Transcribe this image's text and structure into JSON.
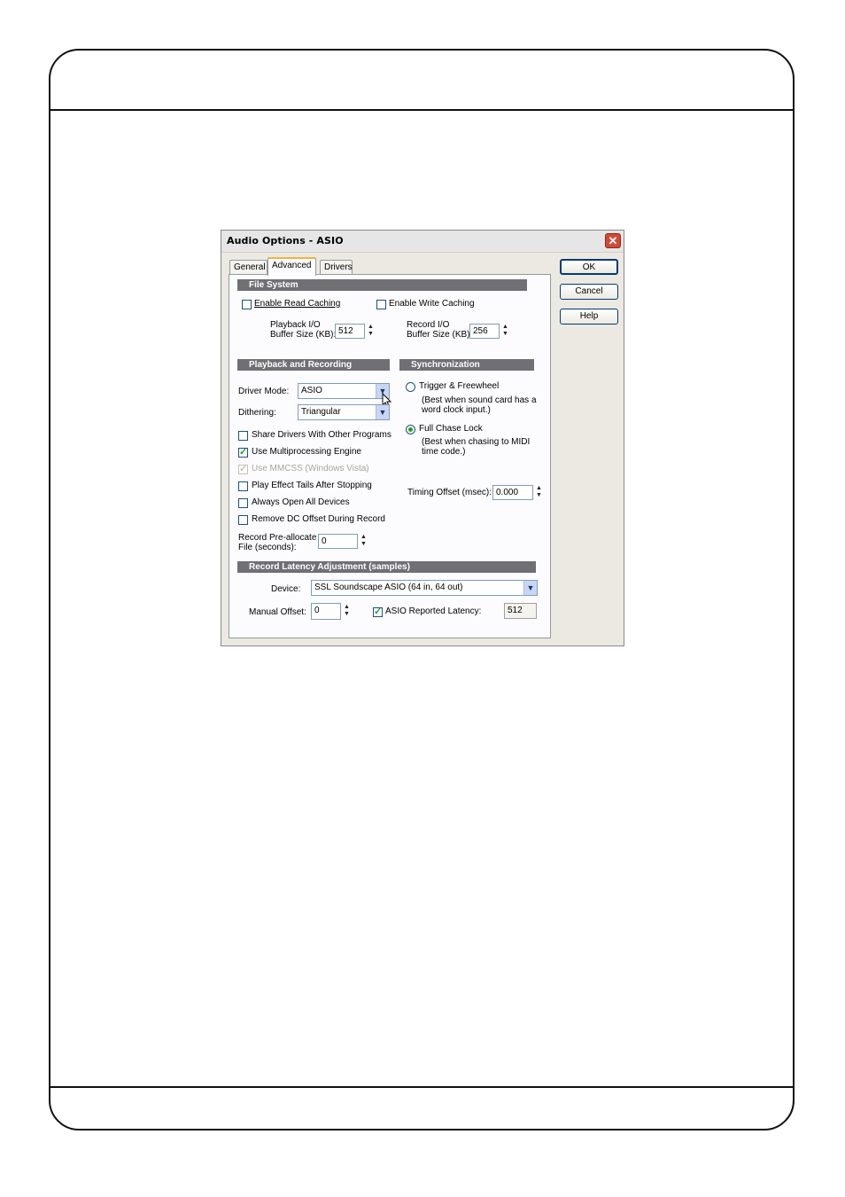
{
  "dialog": {
    "title": "Audio Options - ASIO",
    "close_glyph": "✕"
  },
  "tabs": [
    "General",
    "Advanced",
    "Drivers"
  ],
  "buttons": {
    "ok": "OK",
    "cancel": "Cancel",
    "help": "Help"
  },
  "file_system": {
    "header": "File System",
    "enable_read_caching": {
      "label": "Enable Read Caching",
      "checked": false
    },
    "enable_write_caching": {
      "label": "Enable Write Caching",
      "checked": false
    },
    "playback_buffer": {
      "label_1": "Playback I/O",
      "label_2": "Buffer Size (KB):",
      "value": "512"
    },
    "record_buffer": {
      "label_1": "Record I/O",
      "label_2": "Buffer Size (KB):",
      "value": "256"
    }
  },
  "playback_recording": {
    "header": "Playback and Recording",
    "driver_mode": {
      "label": "Driver Mode:",
      "value": "ASIO"
    },
    "dithering": {
      "label": "Dithering:",
      "value": "Triangular"
    },
    "options": [
      {
        "label": "Share Drivers With Other Programs",
        "checked": false,
        "disabled": false
      },
      {
        "label": "Use Multiprocessing Engine",
        "checked": true,
        "disabled": false
      },
      {
        "label": "Use MMCSS (Windows Vista)",
        "checked": true,
        "disabled": true
      },
      {
        "label": "Play Effect Tails After Stopping",
        "checked": false,
        "disabled": false
      },
      {
        "label": "Always Open All Devices",
        "checked": false,
        "disabled": false
      },
      {
        "label": "Remove DC Offset During Record",
        "checked": false,
        "disabled": false
      }
    ],
    "preallocate": {
      "label_1": "Record Pre-allocate",
      "label_2": "File (seconds):",
      "value": "0"
    }
  },
  "synchronization": {
    "header": "Synchronization",
    "trigger": {
      "label": "Trigger & Freewheel",
      "desc_1": "(Best when sound card has a",
      "desc_2": "word clock input.)",
      "selected": false
    },
    "full_chase": {
      "label": "Full Chase Lock",
      "desc_1": "(Best when chasing to MIDI",
      "desc_2": "time code.)",
      "selected": true
    },
    "timing_offset": {
      "label": "Timing Offset (msec):",
      "value": "0.000"
    }
  },
  "latency": {
    "header": "Record Latency Adjustment (samples)",
    "device": {
      "label": "Device:",
      "value": "SSL Soundscape ASIO (64 in, 64 out)"
    },
    "manual_offset": {
      "label": "Manual Offset:",
      "value": "0"
    },
    "asio_reported": {
      "label": "ASIO Reported Latency:",
      "checked": true,
      "value": "512"
    }
  },
  "glyphs": {
    "dropdown": "▼",
    "spin_up": "▲",
    "spin_down": "▼"
  }
}
